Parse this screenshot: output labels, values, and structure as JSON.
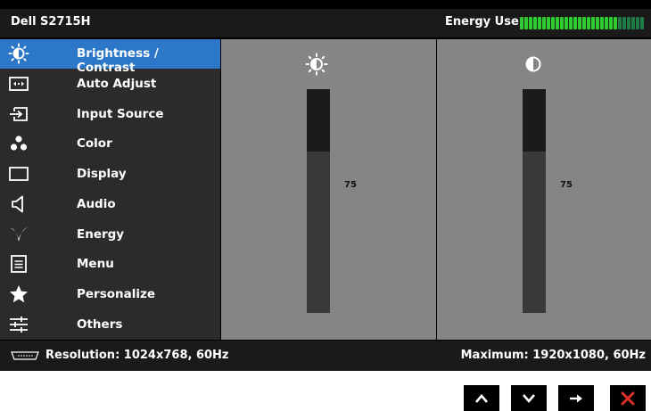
{
  "header": {
    "model": "Dell S2715H",
    "energy_label": "Energy Use",
    "energy_level": 0.8
  },
  "menu": {
    "active_index": 0,
    "items": [
      {
        "label": "Brightness / Contrast",
        "icon": "brightness-icon"
      },
      {
        "label": "Auto Adjust",
        "icon": "auto-adjust-icon"
      },
      {
        "label": "Input Source",
        "icon": "input-source-icon"
      },
      {
        "label": "Color",
        "icon": "color-icon"
      },
      {
        "label": "Display",
        "icon": "display-icon"
      },
      {
        "label": "Audio",
        "icon": "audio-icon"
      },
      {
        "label": "Energy",
        "icon": "energy-icon"
      },
      {
        "label": "Menu",
        "icon": "menu-icon"
      },
      {
        "label": "Personalize",
        "icon": "personalize-icon"
      },
      {
        "label": "Others",
        "icon": "others-icon"
      }
    ]
  },
  "brightness": {
    "value": "75",
    "level": 0.75
  },
  "contrast": {
    "value": "75",
    "level": 0.75
  },
  "status": {
    "resolution": "Resolution: 1024x768, 60Hz",
    "maximum": "Maximum: 1920x1080, 60Hz"
  },
  "colors": {
    "accent": "#2d77c8",
    "energy_on": "#2ecc2e",
    "energy_off": "#1f7a44",
    "close": "#e0302a"
  }
}
